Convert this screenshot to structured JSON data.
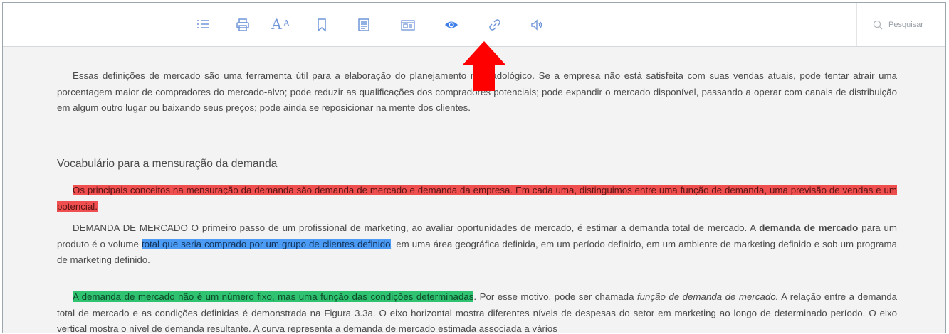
{
  "toolbar": {
    "icons": [
      "list-icon",
      "print-icon",
      "font-size-icon",
      "bookmark-icon",
      "notes-icon",
      "flashcard-icon",
      "eye-icon",
      "link-icon",
      "audio-icon"
    ],
    "font_size_large": "A",
    "font_size_small": "A",
    "search_label": "Pesquisar",
    "accent_color": "#6f96d8"
  },
  "annotation": {
    "arrow_color": "#ff0000"
  },
  "content": {
    "paragraph1": "Essas definições de mercado são uma ferramenta útil para a elaboração do planejamento mercadológico. Se a empresa não está satisfeita com suas vendas atuais, pode tentar atrair uma porcentagem maior de compradores do mercado-alvo; pode reduzir as qualificações dos compradores potenciais; pode expandir o mercado disponível, passando a operar com canais de distribuição em algum outro lugar ou baixando seus preços; pode ainda se reposicionar na mente dos clientes.",
    "heading": "Vocabulário para a mensuração da demanda",
    "paragraph2_highlight_red": "Os principais conceitos na mensuração da demanda são demanda de mercado e demanda da empresa. Em cada uma, distinguimos entre uma função de demanda, uma previsão de vendas e um potencial.",
    "paragraph3": {
      "intro": "DEMANDA DE MERCADO O primeiro passo de um profissional de marketing, ao avaliar oportunidades de mercado, é estimar a demanda total de mercado. A ",
      "term": "demanda de mercado",
      "mid": " para um produto é o volume ",
      "highlight_blue": "total que seria comprado por um grupo de clientes definido",
      "end": ", em uma área geográfica definida, em um período definido, em um ambiente de marketing definido e sob um programa de marketing definido."
    },
    "paragraph4": {
      "highlight_green": "A demanda de mercado não é um número fixo, mas uma função das condições determinadas",
      "mid": ". Por esse motivo, pode ser chamada ",
      "italic": "função de demanda de mercado.",
      "end": " A relação entre a demanda total de mercado e as condições definidas é demonstrada na Figura 3.3a. O eixo horizontal mostra diferentes níveis de despesas do setor em marketing ao longo de determinado período. O eixo vertical mostra o nível de demanda resultante. A curva representa a demanda de mercado estimada associada a vários"
    },
    "highlight_colors": {
      "red": "#ef4f4f",
      "blue": "#4c9cf5",
      "green": "#2ec271"
    }
  }
}
